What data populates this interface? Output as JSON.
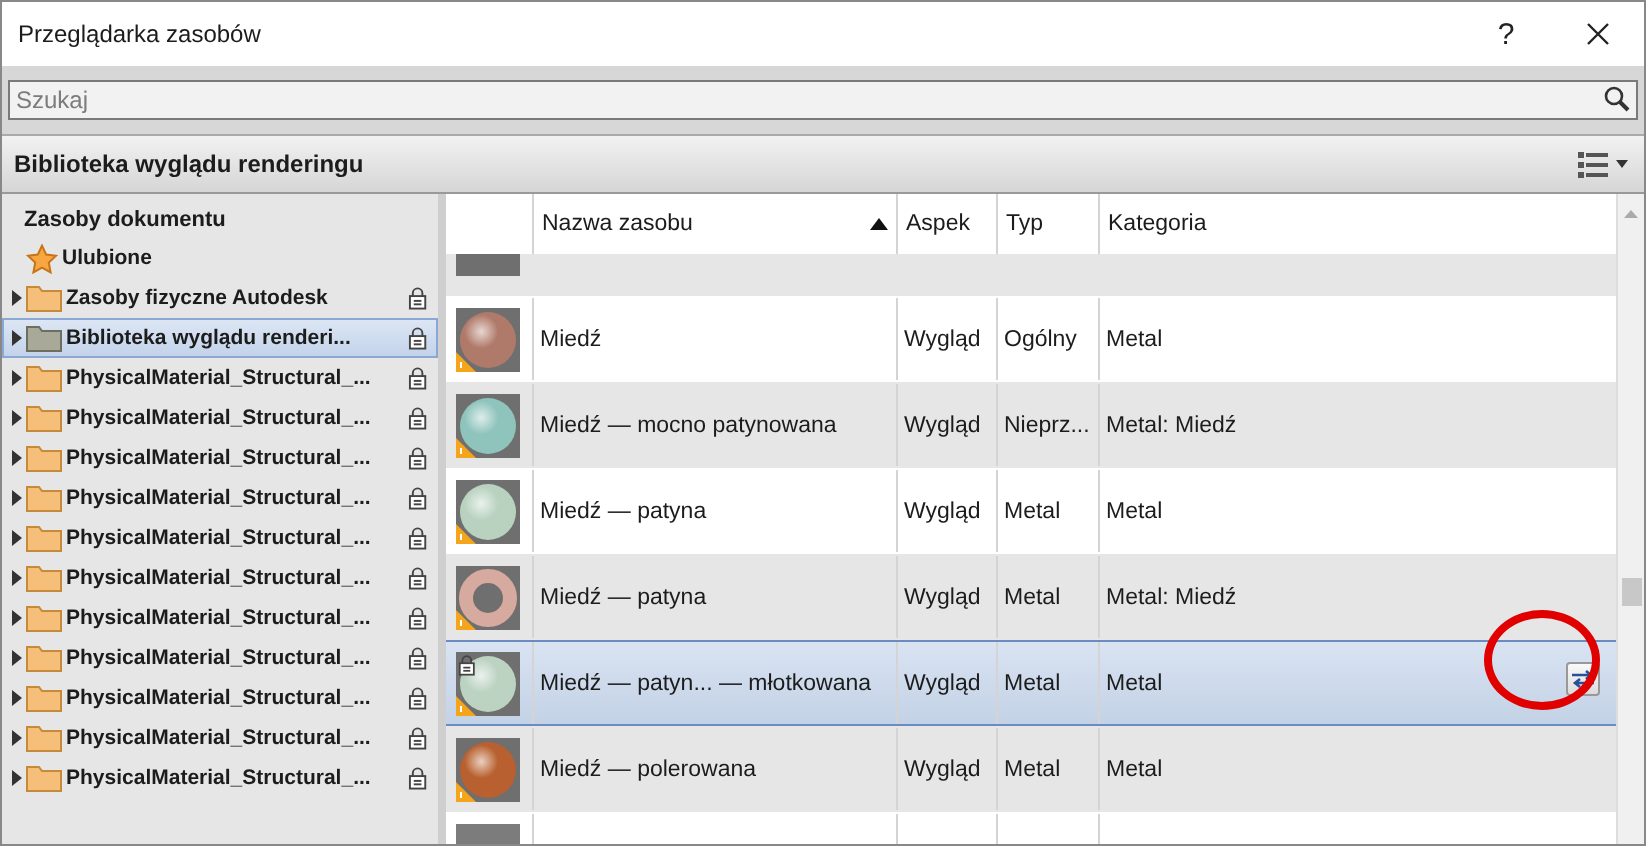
{
  "window": {
    "title": "Przeglądarka zasobów",
    "help": "?"
  },
  "search": {
    "placeholder": "Szukaj"
  },
  "library_header": {
    "title": "Biblioteka wyglądu renderingu"
  },
  "tree": {
    "heading": "Zasoby dokumentu",
    "items": [
      {
        "label": "Ulubione",
        "kind": "star",
        "expandable": false,
        "locked": false,
        "selected": false
      },
      {
        "label": "Zasoby fizyczne Autodesk",
        "kind": "folder",
        "expandable": true,
        "locked": true,
        "selected": false
      },
      {
        "label": "Biblioteka wyglądu renderi...",
        "kind": "folder",
        "expandable": true,
        "locked": true,
        "selected": true
      },
      {
        "label": "PhysicalMaterial_Structural_...",
        "kind": "folder",
        "expandable": true,
        "locked": true,
        "selected": false
      },
      {
        "label": "PhysicalMaterial_Structural_...",
        "kind": "folder",
        "expandable": true,
        "locked": true,
        "selected": false
      },
      {
        "label": "PhysicalMaterial_Structural_...",
        "kind": "folder",
        "expandable": true,
        "locked": true,
        "selected": false
      },
      {
        "label": "PhysicalMaterial_Structural_...",
        "kind": "folder",
        "expandable": true,
        "locked": true,
        "selected": false
      },
      {
        "label": "PhysicalMaterial_Structural_...",
        "kind": "folder",
        "expandable": true,
        "locked": true,
        "selected": false
      },
      {
        "label": "PhysicalMaterial_Structural_...",
        "kind": "folder",
        "expandable": true,
        "locked": true,
        "selected": false
      },
      {
        "label": "PhysicalMaterial_Structural_...",
        "kind": "folder",
        "expandable": true,
        "locked": true,
        "selected": false
      },
      {
        "label": "PhysicalMaterial_Structural_...",
        "kind": "folder",
        "expandable": true,
        "locked": true,
        "selected": false
      },
      {
        "label": "PhysicalMaterial_Structural_...",
        "kind": "folder",
        "expandable": true,
        "locked": true,
        "selected": false
      },
      {
        "label": "PhysicalMaterial_Structural_...",
        "kind": "folder",
        "expandable": true,
        "locked": true,
        "selected": false
      },
      {
        "label": "PhysicalMaterial_Structural_...",
        "kind": "folder",
        "expandable": true,
        "locked": true,
        "selected": false
      }
    ]
  },
  "table": {
    "columns": [
      {
        "label": "Nazwa zasobu",
        "sorted": true
      },
      {
        "label": "Aspek",
        "sorted": false
      },
      {
        "label": "Typ",
        "sorted": false
      },
      {
        "label": "Kategoria",
        "sorted": false
      }
    ],
    "rows": [
      {
        "name": "Miedź",
        "aspect": "Wygląd",
        "type": "Ogólny",
        "category": "Metal",
        "kind": "sphere",
        "color": "#b07a6a",
        "locked": false,
        "selected": false,
        "swap_button": false
      },
      {
        "name": "Miedź — mocno patynowana",
        "aspect": "Wygląd",
        "type": "Nieprz...",
        "category": "Metal: Miedź",
        "kind": "sphere",
        "color": "#8fc4bd",
        "locked": false,
        "selected": false,
        "swap_button": false
      },
      {
        "name": "Miedź — patyna",
        "aspect": "Wygląd",
        "type": "Metal",
        "category": "Metal",
        "kind": "sphere",
        "color": "#b9d2c0",
        "locked": false,
        "selected": false,
        "swap_button": false
      },
      {
        "name": "Miedź — patyna",
        "aspect": "Wygląd",
        "type": "Metal",
        "category": "Metal: Miedź",
        "kind": "torus",
        "color": "#d7aaa0",
        "locked": false,
        "selected": false,
        "swap_button": false
      },
      {
        "name": "Miedź — patyn... — młotkowana",
        "aspect": "Wygląd",
        "type": "Metal",
        "category": "Metal",
        "kind": "sphere",
        "color": "#bcd3c2",
        "locked": true,
        "selected": true,
        "swap_button": true
      },
      {
        "name": "Miedź — polerowana",
        "aspect": "Wygląd",
        "type": "Metal",
        "category": "Metal",
        "kind": "sphere",
        "color": "#b8602f",
        "locked": false,
        "selected": false,
        "swap_button": false
      }
    ]
  }
}
